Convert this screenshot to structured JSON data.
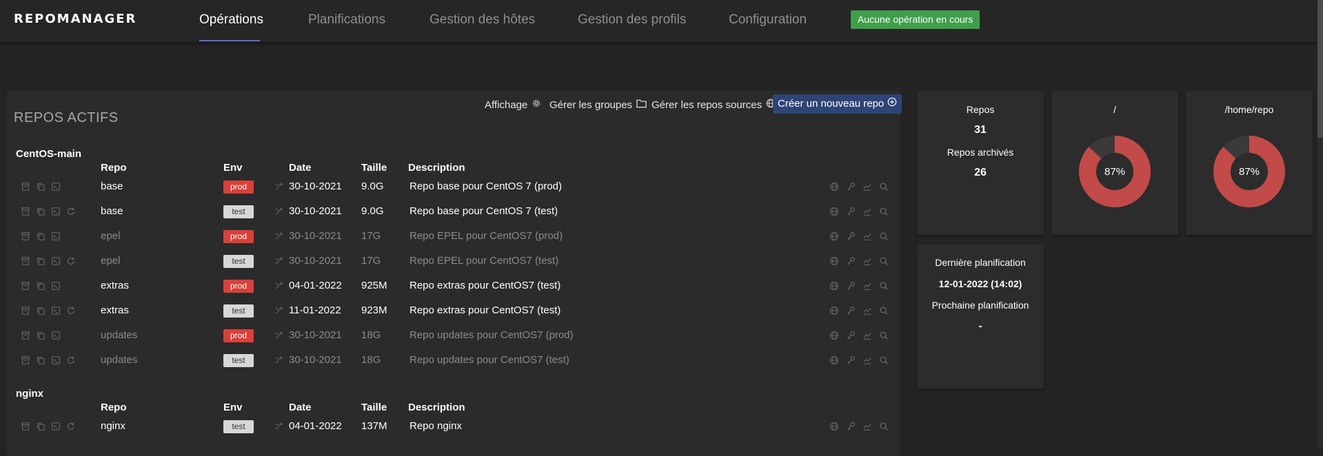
{
  "brand": "REPOMANAGER",
  "nav": [
    {
      "label": "Opérations",
      "active": true
    },
    {
      "label": "Planifications",
      "active": false
    },
    {
      "label": "Gestion des hôtes",
      "active": false
    },
    {
      "label": "Gestion des profils",
      "active": false
    },
    {
      "label": "Configuration",
      "active": false
    }
  ],
  "status_badge": "Aucune opération en cours",
  "section_title": "REPOS ACTIFS",
  "toolbar": {
    "display": "Affichage",
    "groups": "Gérer les groupes",
    "sources": "Gérer les repos sources",
    "create": "Créer un nouveau repo"
  },
  "columns": [
    "Repo",
    "Env",
    "Date",
    "Taille",
    "Description"
  ],
  "groups": [
    {
      "name": "CentOS-main",
      "rows": [
        {
          "repo": "base",
          "env": "prod",
          "date": "30-10-2021",
          "size": "9.0G",
          "description": "Repo base pour CentOS 7 (prod)",
          "dim": false,
          "restore": false
        },
        {
          "repo": "base",
          "env": "test",
          "date": "30-10-2021",
          "size": "9.0G",
          "description": "Repo base pour CentOS 7 (test)",
          "dim": false,
          "restore": true
        },
        {
          "repo": "epel",
          "env": "prod",
          "date": "30-10-2021",
          "size": "17G",
          "description": "Repo EPEL pour CentOS7 (prod)",
          "dim": true,
          "restore": false
        },
        {
          "repo": "epel",
          "env": "test",
          "date": "30-10-2021",
          "size": "17G",
          "description": "Repo EPEL pour CentOS7 (test)",
          "dim": true,
          "restore": true
        },
        {
          "repo": "extras",
          "env": "prod",
          "date": "04-01-2022",
          "size": "925M",
          "description": "Repo extras pour CentOS7 (test)",
          "dim": false,
          "restore": false
        },
        {
          "repo": "extras",
          "env": "test",
          "date": "11-01-2022",
          "size": "923M",
          "description": "Repo extras pour CentOS7 (test)",
          "dim": false,
          "restore": true
        },
        {
          "repo": "updates",
          "env": "prod",
          "date": "30-10-2021",
          "size": "18G",
          "description": "Repo updates pour CentOS7 (prod)",
          "dim": true,
          "restore": false
        },
        {
          "repo": "updates",
          "env": "test",
          "date": "30-10-2021",
          "size": "18G",
          "description": "Repo updates pour CentOS7 (test)",
          "dim": true,
          "restore": true
        }
      ]
    },
    {
      "name": "nginx",
      "rows": [
        {
          "repo": "nginx",
          "env": "test",
          "date": "04-01-2022",
          "size": "137M",
          "description": "Repo nginx",
          "dim": false,
          "restore": true
        }
      ]
    }
  ],
  "stats": {
    "repos_label": "Repos",
    "repos_count": "31",
    "archived_label": "Repos archivés",
    "archived_count": "26"
  },
  "disks": [
    {
      "path": "/",
      "percent": 87,
      "label": "87%"
    },
    {
      "path": "/home/repo",
      "percent": 87,
      "label": "87%"
    }
  ],
  "planning": {
    "last_label": "Dernière planification",
    "last_value": "12-01-2022 (14:02)",
    "next_label": "Prochaine planification",
    "next_value": "-"
  },
  "colors": {
    "accent": "#5b6fc8",
    "status_green": "#3f9e4a",
    "prod_red": "#d9403a",
    "test_grey": "#d7d7d7",
    "primary_button": "#2d4476",
    "disk_used": "#c24a48",
    "disk_free": "#3a3a3a"
  },
  "icons": {
    "actions": [
      "archive-icon",
      "duplicate-icon",
      "terminal-icon",
      "restore-icon"
    ],
    "row_right": [
      "globe-icon",
      "key-icon",
      "chart-icon",
      "search-icon"
    ],
    "toolbar": [
      "gear-icon",
      "folder-icon",
      "globe-icon",
      "plus-circle-icon"
    ]
  }
}
